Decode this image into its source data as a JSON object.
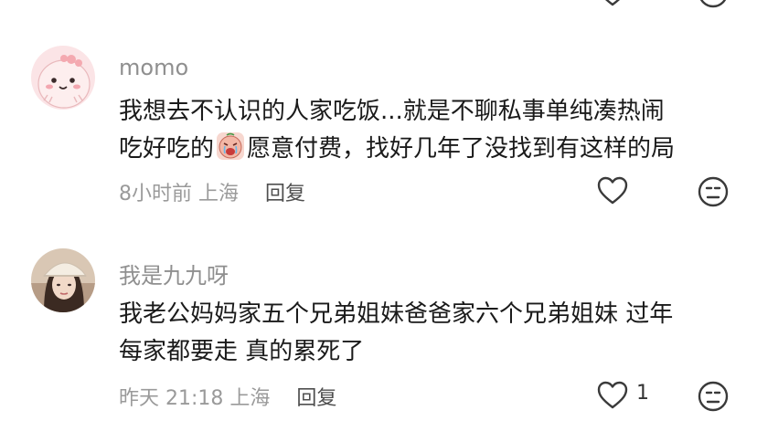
{
  "comments": [
    {
      "username": "momo",
      "content_line1": "我想去不认识的人家吃饭...就是不聊私事单纯凑热闹",
      "content_line2_before_emoji": "吃好吃的",
      "content_line2_after_emoji": "愿意付费，找好几年了没找到有这样的局",
      "time": "8小时前",
      "location": "上海",
      "reply_label": "回复",
      "like_count": ""
    },
    {
      "username": "我是九九呀",
      "content_line1": "我老公妈妈家五个兄弟姐妹爸爸家六个兄弟姐妹 过年",
      "content_line2": "每家都要走 真的累死了",
      "time": "昨天 21:18",
      "location": "上海",
      "reply_label": "回复",
      "like_count": "1"
    }
  ],
  "colors": {
    "username": "#8f8f8f",
    "text": "#1a1a1a",
    "meta": "#9a9a9a",
    "reply": "#4f4f4f",
    "icon": "#3a3a3a"
  },
  "icons": [
    "heart-outline-icon",
    "dislike-face-icon",
    "crying-emoji"
  ]
}
